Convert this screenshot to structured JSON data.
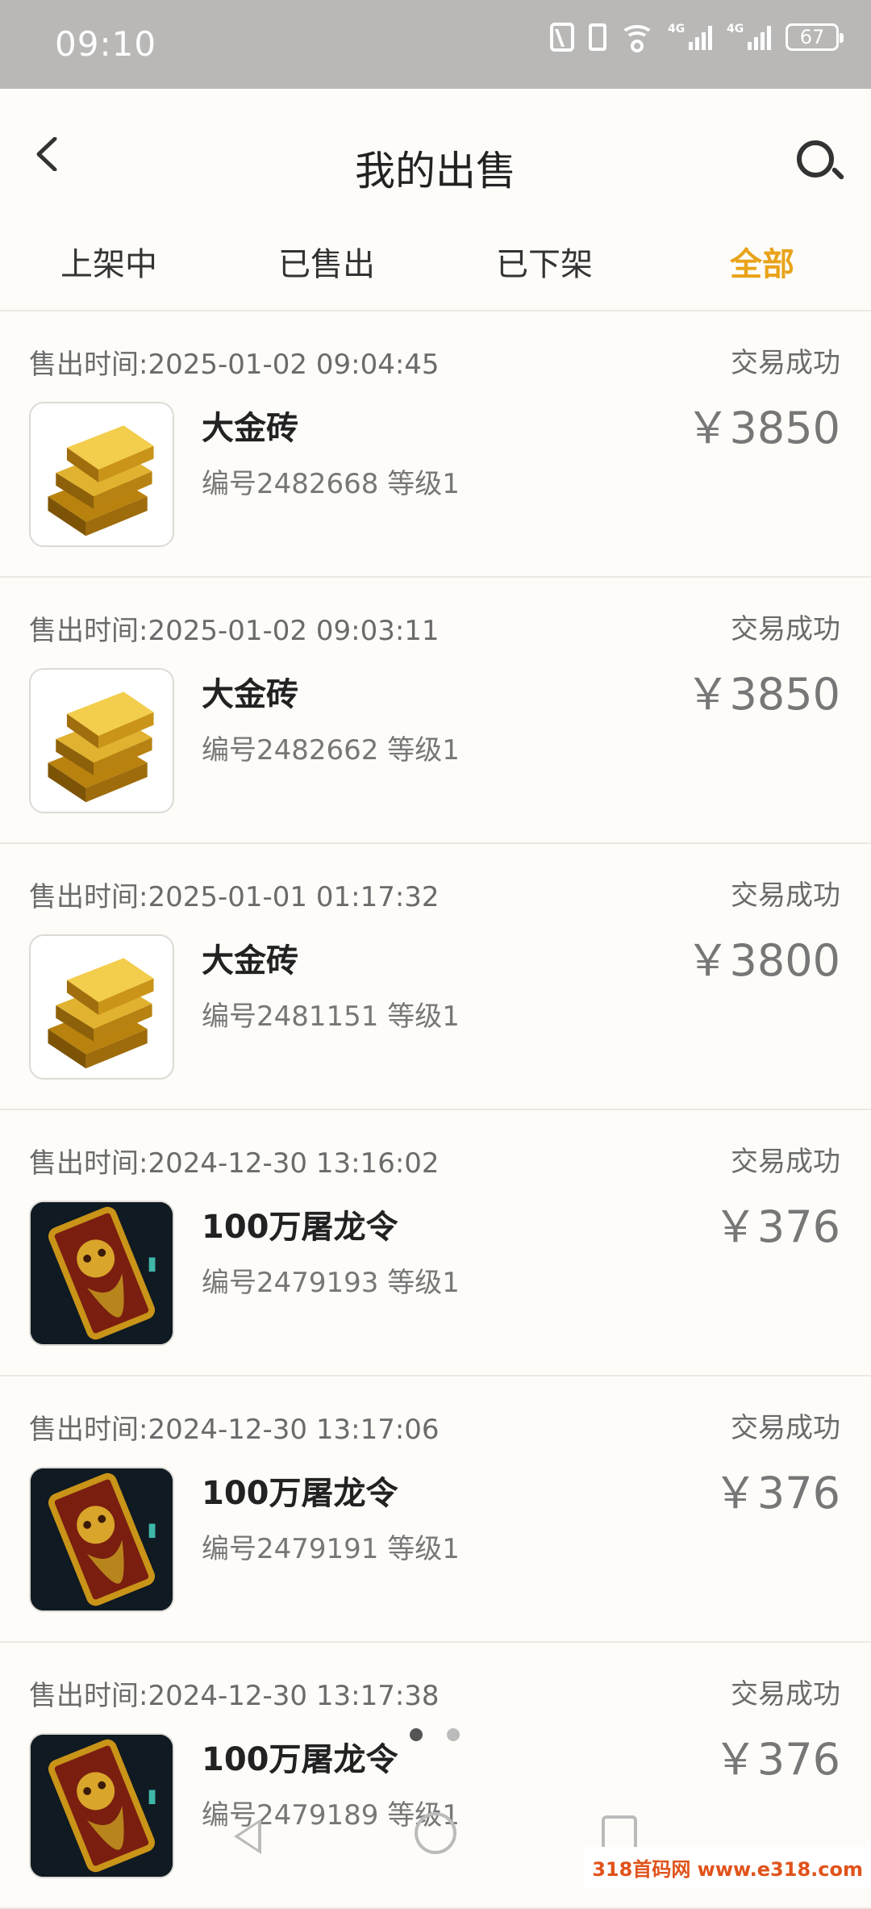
{
  "status_bar": {
    "time": "09:10",
    "battery": "67"
  },
  "header": {
    "title": "我的出售"
  },
  "tabs": [
    {
      "label": "上架中",
      "active": false
    },
    {
      "label": "已售出",
      "active": false
    },
    {
      "label": "已下架",
      "active": false
    },
    {
      "label": "全部",
      "active": true
    }
  ],
  "colors": {
    "accent": "#e9a31a",
    "background": "#fdfcf9",
    "status_bar": "#b9b8b6"
  },
  "orders": [
    {
      "sale_time": "售出时间:2025-01-02 09:04:45",
      "status": "交易成功",
      "name": "大金砖",
      "meta": "编号2482668 等级1",
      "price": "￥3850",
      "icon": "gold-bar-icon"
    },
    {
      "sale_time": "售出时间:2025-01-02 09:03:11",
      "status": "交易成功",
      "name": "大金砖",
      "meta": "编号2482662 等级1",
      "price": "￥3850",
      "icon": "gold-bar-icon"
    },
    {
      "sale_time": "售出时间:2025-01-01 01:17:32",
      "status": "交易成功",
      "name": "大金砖",
      "meta": "编号2481151 等级1",
      "price": "￥3800",
      "icon": "gold-bar-icon"
    },
    {
      "sale_time": "售出时间:2024-12-30 13:16:02",
      "status": "交易成功",
      "name": "100万屠龙令",
      "meta": "编号2479193 等级1",
      "price": "￥376",
      "icon": "dragon-token-icon"
    },
    {
      "sale_time": "售出时间:2024-12-30 13:17:06",
      "status": "交易成功",
      "name": "100万屠龙令",
      "meta": "编号2479191 等级1",
      "price": "￥376",
      "icon": "dragon-token-icon"
    },
    {
      "sale_time": "售出时间:2024-12-30 13:17:38",
      "status": "交易成功",
      "name": "100万屠龙令",
      "meta": "编号2479189 等级1",
      "price": "￥376",
      "icon": "dragon-token-icon"
    }
  ],
  "watermark": "318首码网 www.e318.com"
}
